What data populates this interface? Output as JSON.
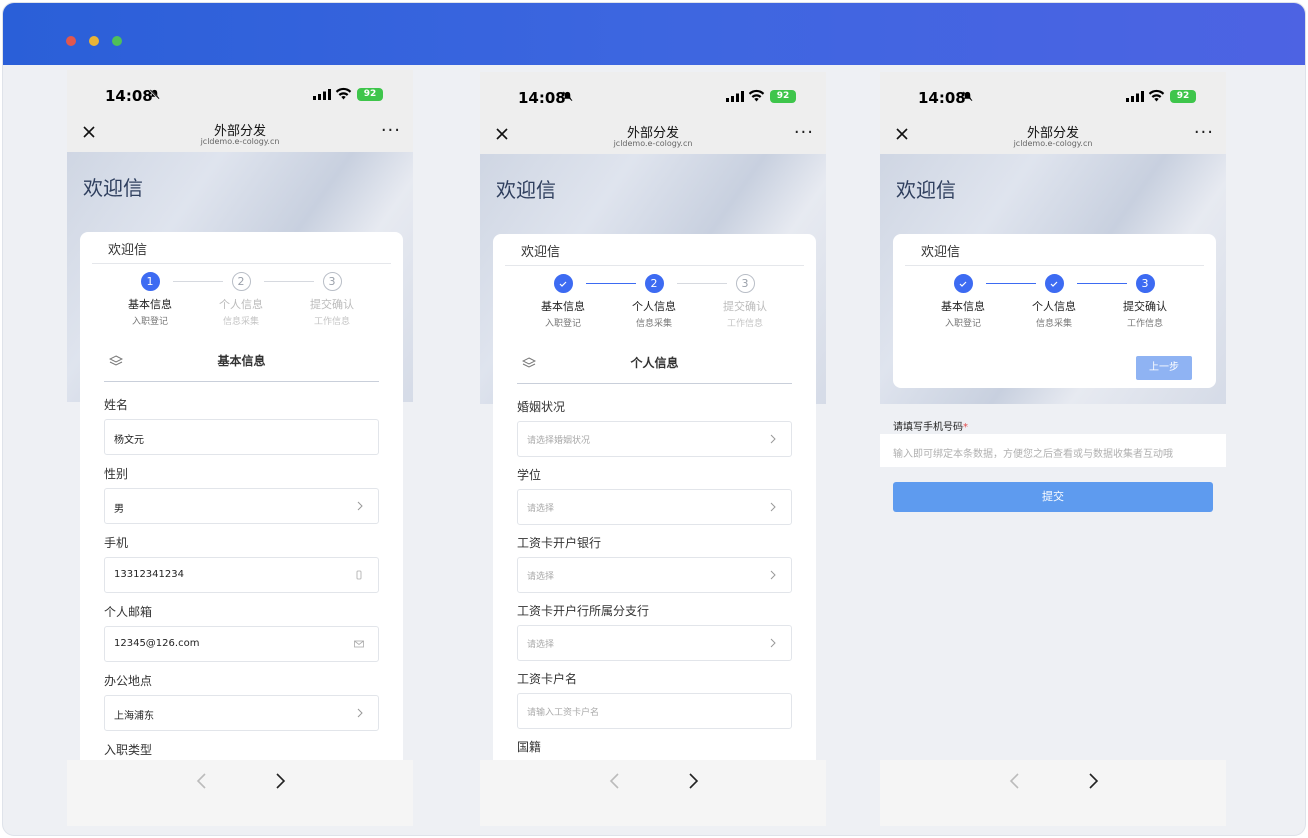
{
  "status_bar": {
    "time": "14:08",
    "battery": "92"
  },
  "navbar": {
    "title": "外部分发",
    "subtitle": "jcldemo.e-cology.cn",
    "more": "···"
  },
  "hero_title": "欢迎信",
  "card_title": "欢迎信",
  "steps": [
    {
      "num": "1",
      "name": "基本信息",
      "sub": "入职登记"
    },
    {
      "num": "2",
      "name": "个人信息",
      "sub": "信息采集"
    },
    {
      "num": "3",
      "name": "提交确认",
      "sub": "工作信息"
    }
  ],
  "screen1": {
    "section_title": "基本信息",
    "fields": [
      {
        "label": "姓名",
        "value": "杨文元"
      },
      {
        "label": "性别",
        "value": "男"
      },
      {
        "label": "手机",
        "value": "13312341234"
      },
      {
        "label": "个人邮箱",
        "value": "12345@126.com"
      },
      {
        "label": "办公地点",
        "value": "上海浦东"
      },
      {
        "label": "入职类型",
        "value": ""
      }
    ]
  },
  "screen2": {
    "section_title": "个人信息",
    "fields": [
      {
        "label": "婚姻状况",
        "placeholder": "请选择婚姻状况"
      },
      {
        "label": "学位",
        "placeholder": "请选择"
      },
      {
        "label": "工资卡开户银行",
        "placeholder": "请选择"
      },
      {
        "label": "工资卡开户行所属分支行",
        "placeholder": "请选择"
      },
      {
        "label": "工资卡户名",
        "placeholder": "请输入工资卡户名"
      },
      {
        "label": "国籍",
        "placeholder": ""
      }
    ]
  },
  "screen3": {
    "prev_button": "上一步",
    "phone_label": "请填写手机号码",
    "required_mark": "*",
    "phone_placeholder": "输入即可绑定本条数据，方便您之后查看或与数据收集者互动哦",
    "submit_button": "提交"
  },
  "colors": {
    "accent": "#3d6bf2",
    "submit": "#5e9bef",
    "title_bar": "#2a5fd8"
  }
}
